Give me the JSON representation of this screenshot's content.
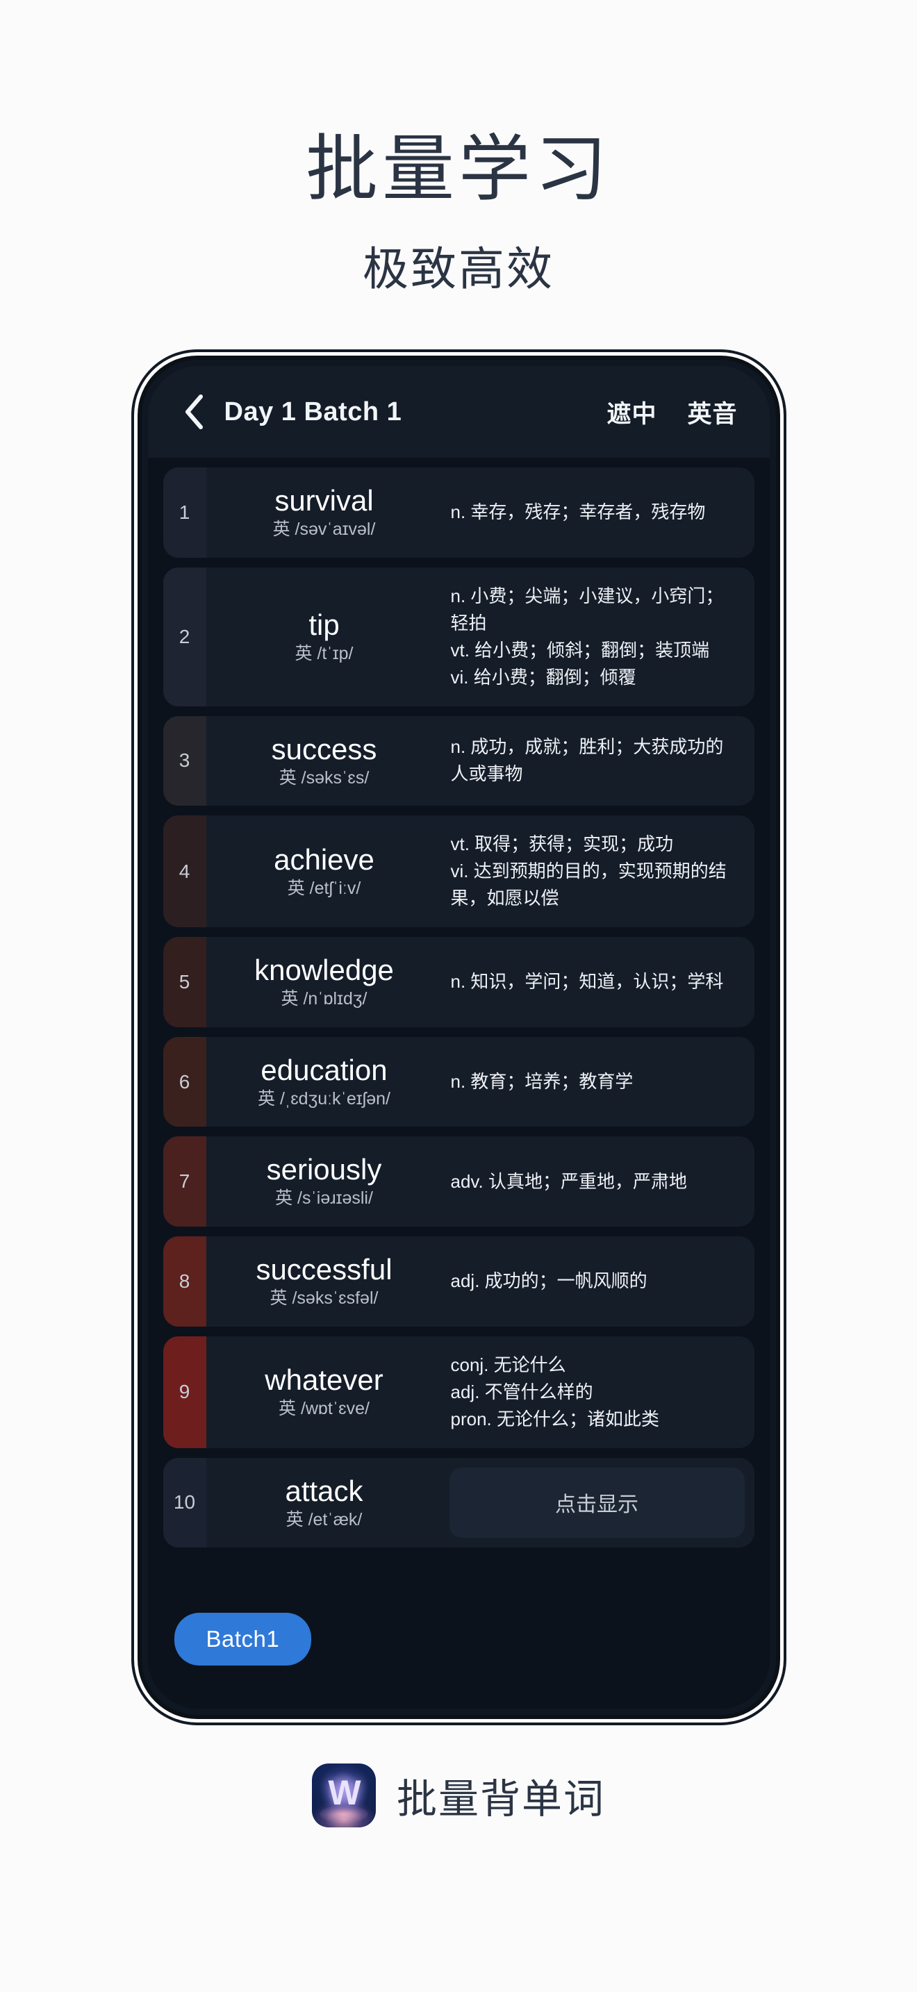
{
  "promo": {
    "headline": "批量学习",
    "subheadline": "极致高效"
  },
  "app": {
    "header": {
      "back_icon": "chevron-left-icon",
      "title": "Day 1 Batch 1",
      "action_mask": "遮中",
      "action_accent": "英音"
    },
    "words": [
      {
        "index": "1",
        "term": "survival",
        "phonetic": "英 /səvˈaɪvəl/",
        "definition": "n. 幸存，残存；幸存者，残存物",
        "revealed": true,
        "heat_color": "#1c2230"
      },
      {
        "index": "2",
        "term": "tip",
        "phonetic": "英 /tˈɪp/",
        "definition": "n. 小费；尖端；小建议，小窍门；\n轻拍\nvt. 给小费；倾斜；翻倒；装顶端\nvi. 给小费；翻倒；倾覆",
        "revealed": true,
        "heat_color": "#1e2431"
      },
      {
        "index": "3",
        "term": "success",
        "phonetic": "英 /səksˈɛs/",
        "definition": "n. 成功，成就；胜利；大获成功的\n人或事物",
        "revealed": true,
        "heat_color": "#26262c"
      },
      {
        "index": "4",
        "term": "achieve",
        "phonetic": "英 /etʃˈiːv/",
        "definition": "vt. 取得；获得；实现；成功\nvi. 达到预期的目的，实现预期的结\n果，如愿以偿",
        "revealed": true,
        "heat_color": "#2c1f22"
      },
      {
        "index": "5",
        "term": "knowledge",
        "phonetic": "英 /nˈɒlɪdʒ/",
        "definition": "n. 知识，学问；知道，认识；学科",
        "revealed": true,
        "heat_color": "#331f1e"
      },
      {
        "index": "6",
        "term": "education",
        "phonetic": "英 /ˌɛdʒuːkˈeɪʃən/",
        "definition": "n. 教育；培养；教育学",
        "revealed": true,
        "heat_color": "#3b211d"
      },
      {
        "index": "7",
        "term": "seriously",
        "phonetic": "英 /sˈiəɹɪəsli/",
        "definition": "adv. 认真地；严重地，严肃地",
        "revealed": true,
        "heat_color": "#4a211e"
      },
      {
        "index": "8",
        "term": "successful",
        "phonetic": "英 /səksˈɛsfəl/",
        "definition": "adj. 成功的；一帆风顺的",
        "revealed": true,
        "heat_color": "#5d211e"
      },
      {
        "index": "9",
        "term": "whatever",
        "phonetic": "英 /wɒtˈɛve/",
        "definition": "conj. 无论什么\nadj. 不管什么样的\npron. 无论什么；诸如此类",
        "revealed": true,
        "heat_color": "#6e1f1d"
      },
      {
        "index": "10",
        "term": "attack",
        "phonetic": "英 /etˈæk/",
        "definition": "",
        "reveal_label": "点击显示",
        "revealed": false,
        "heat_color": "#1b2231"
      }
    ],
    "bottom": {
      "batch_label": "Batch1",
      "accent_color": "#2f79d8"
    }
  },
  "brand": {
    "logo_icon": "app-logo-w-icon",
    "logo_letter": "W",
    "name": "批量背单词"
  }
}
